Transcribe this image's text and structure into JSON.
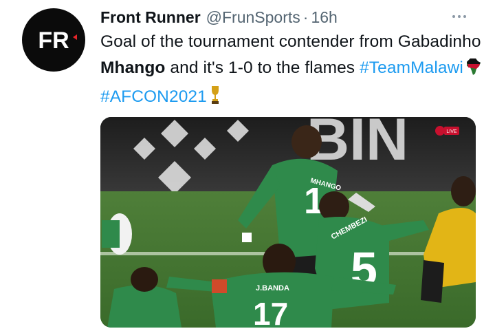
{
  "author": {
    "name": "Front Runner",
    "handle": "@FrunSports",
    "separator": "·",
    "time": "16h",
    "avatar_text": "FR"
  },
  "tweet": {
    "text_before": "Goal of the tournament contender from Gabadinho ",
    "bold_name": "Mhango",
    "text_after": " and it's 1-0 to the flames ",
    "hashtag1": "#TeamMalawi",
    "hashtag2": "#AFCON2021"
  },
  "media": {
    "jersey_names": [
      "MHANGO",
      "CHEMBEZI",
      "J.BANDA"
    ],
    "jersey_numbers": [
      "1",
      "5",
      "17"
    ],
    "banner_text": "BIN",
    "broadcast_badge": "LIVE"
  },
  "colors": {
    "link": "#1d9bf0",
    "muted": "#536471",
    "jersey_green": "#2f8a4b",
    "pitch": "#4c7a37"
  },
  "icons": {
    "more": "more-horizontal-icon",
    "emoji1": "africa-flag-emoji",
    "emoji2": "trophy-emoji"
  }
}
